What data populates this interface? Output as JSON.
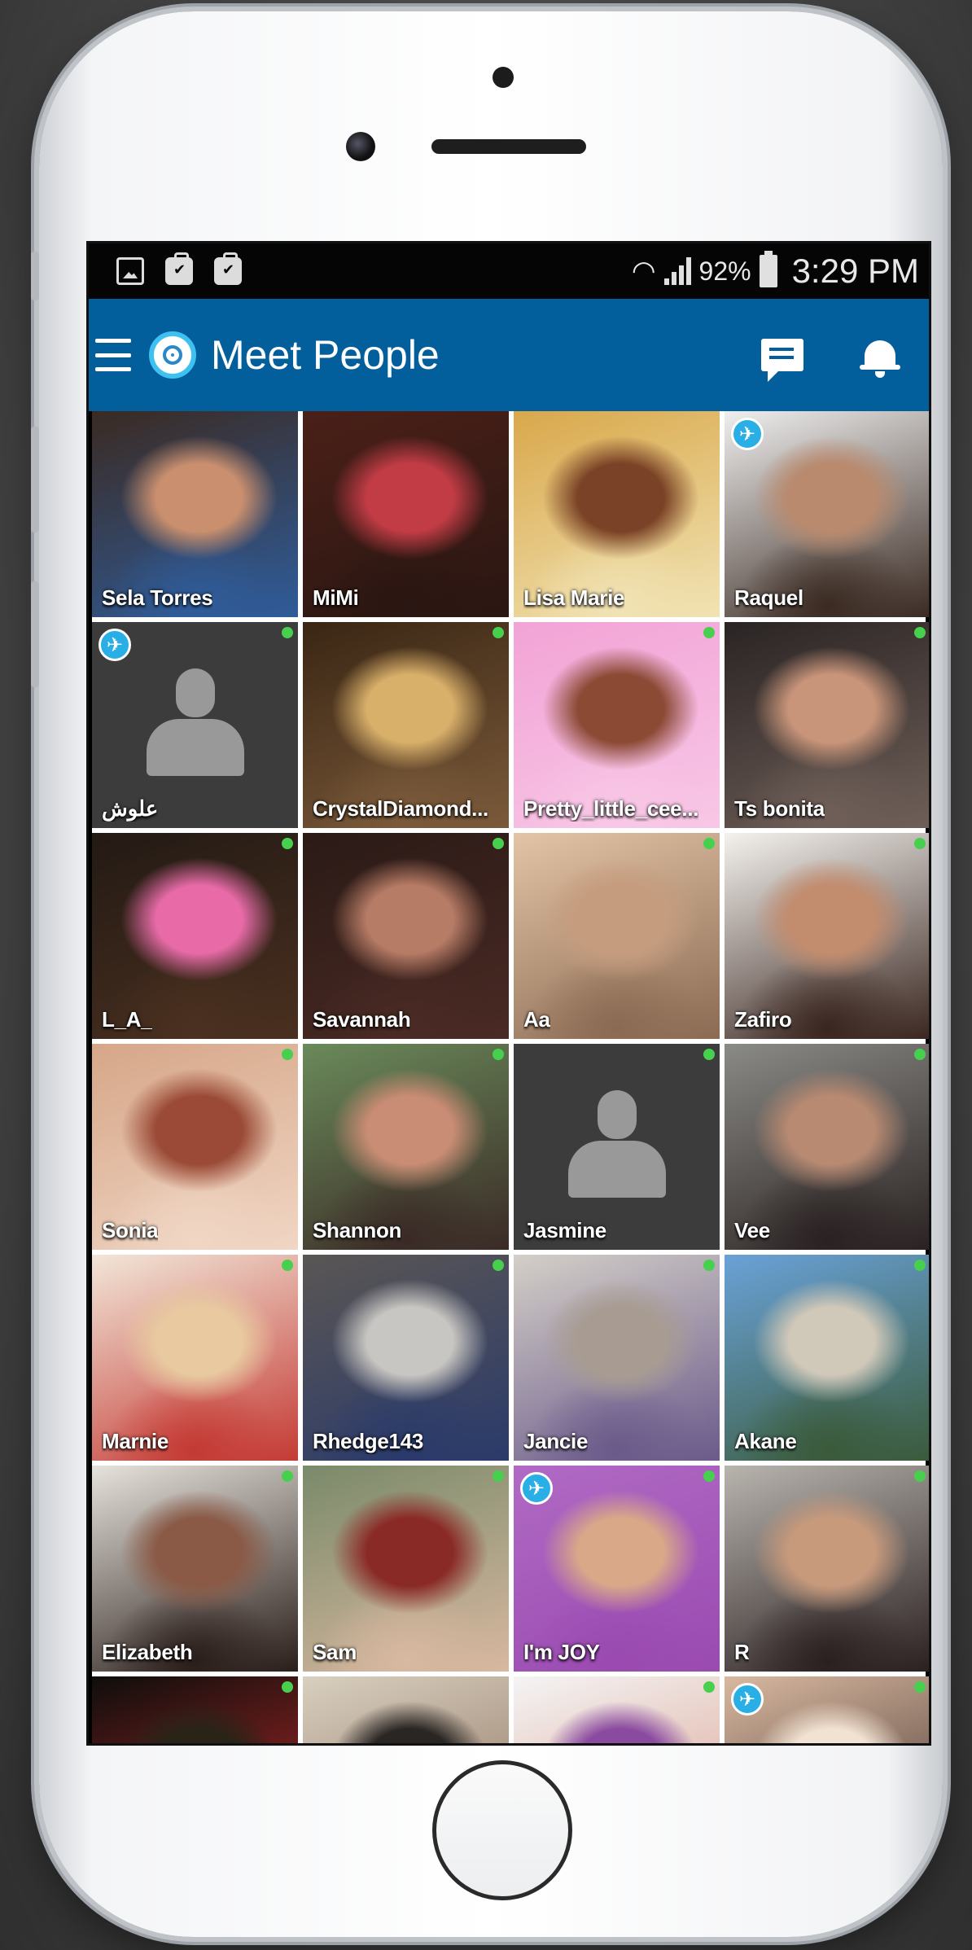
{
  "status_bar": {
    "left_icons": [
      "image-icon",
      "briefcase-check-icon",
      "briefcase-check-icon"
    ],
    "wifi_icon": "wifi-icon",
    "signal_icon": "signal-icon",
    "battery_percent": "92%",
    "battery_icon": "battery-icon",
    "time": "3:29 PM"
  },
  "app_bar": {
    "menu_icon": "hamburger-menu-icon",
    "logo_icon": "app-logo-icon",
    "title": "Meet People",
    "chat_icon": "chat-icon",
    "notifications_icon": "bell-icon",
    "background_color": "#035e9c"
  },
  "colors": {
    "online_indicator": "#47d04d",
    "travel_badge": "#29aee6",
    "placeholder_bg": "#3c3c3c"
  },
  "profiles": [
    {
      "name": "Sela Torres",
      "online": false,
      "travel": false,
      "photo": true,
      "tones": [
        "#3b2a22",
        "#c98f6e",
        "#2f5c9a"
      ]
    },
    {
      "name": "MiMi",
      "online": false,
      "travel": false,
      "photo": true,
      "tones": [
        "#4a2018",
        "#c23c46",
        "#2a1612"
      ]
    },
    {
      "name": "Lisa Marie",
      "online": false,
      "travel": false,
      "photo": true,
      "tones": [
        "#d9a84b",
        "#7a4226",
        "#f1e3b4"
      ]
    },
    {
      "name": "Raquel",
      "online": false,
      "travel": true,
      "photo": true,
      "tones": [
        "#efefef",
        "#b98a6e",
        "#3a2a22"
      ]
    },
    {
      "name": "علوش",
      "online": true,
      "travel": true,
      "photo": false,
      "tones": []
    },
    {
      "name": "CrystalDiamond...",
      "online": true,
      "travel": false,
      "photo": true,
      "tones": [
        "#3a2614",
        "#d9b06a",
        "#7b5a3a"
      ]
    },
    {
      "name": "Pretty_little_cee...",
      "online": true,
      "travel": false,
      "photo": true,
      "tones": [
        "#f2a3d6",
        "#8b4a34",
        "#f8c7e6"
      ]
    },
    {
      "name": "Ts bonita",
      "online": true,
      "travel": false,
      "photo": true,
      "tones": [
        "#2a2424",
        "#c9957a",
        "#6f5f58"
      ]
    },
    {
      "name": "L_A_",
      "online": true,
      "travel": false,
      "photo": true,
      "tones": [
        "#231a14",
        "#e86ba8",
        "#4a3020"
      ]
    },
    {
      "name": "Savannah",
      "online": true,
      "travel": false,
      "photo": true,
      "tones": [
        "#2a1a16",
        "#b77c66",
        "#4a2a24"
      ]
    },
    {
      "name": "Aa",
      "online": true,
      "travel": false,
      "photo": true,
      "tones": [
        "#e4c4a6",
        "#c69c7e",
        "#8a6a52"
      ]
    },
    {
      "name": "Zafiro",
      "online": true,
      "travel": false,
      "photo": true,
      "tones": [
        "#f4f2ee",
        "#c28c6e",
        "#3a2620"
      ]
    },
    {
      "name": "Sonia",
      "online": true,
      "travel": false,
      "photo": true,
      "tones": [
        "#d6a688",
        "#9a4a36",
        "#f0d6c4"
      ]
    },
    {
      "name": "Shannon",
      "online": true,
      "travel": false,
      "photo": true,
      "tones": [
        "#6a8a5a",
        "#c98c74",
        "#3a2a26"
      ]
    },
    {
      "name": "Jasmine",
      "online": true,
      "travel": false,
      "photo": false,
      "tones": []
    },
    {
      "name": "Vee",
      "online": true,
      "travel": false,
      "photo": true,
      "tones": [
        "#8a8a86",
        "#b88a72",
        "#2a2222"
      ]
    },
    {
      "name": "Marnie",
      "online": true,
      "travel": false,
      "photo": true,
      "tones": [
        "#f2e6d8",
        "#e8c9a0",
        "#c43a34"
      ]
    },
    {
      "name": "Rhedge143",
      "online": true,
      "travel": false,
      "photo": true,
      "tones": [
        "#5a5654",
        "#c8c6c2",
        "#2a3a6a"
      ]
    },
    {
      "name": "Jancie",
      "online": true,
      "travel": false,
      "photo": true,
      "tones": [
        "#d4cfc8",
        "#a89c92",
        "#6a5a8a"
      ]
    },
    {
      "name": "Akane",
      "online": true,
      "travel": false,
      "photo": true,
      "tones": [
        "#6aa2d8",
        "#d0c8b8",
        "#3a5a3a"
      ]
    },
    {
      "name": "Elizabeth",
      "online": true,
      "travel": false,
      "photo": true,
      "tones": [
        "#e6e2dc",
        "#8a5a46",
        "#2a1e1a"
      ]
    },
    {
      "name": "Sam",
      "online": true,
      "travel": false,
      "photo": true,
      "tones": [
        "#7a8a6a",
        "#8a2a26",
        "#d8b8a0"
      ]
    },
    {
      "name": "I'm JOY",
      "online": true,
      "travel": true,
      "photo": true,
      "tones": [
        "#b06ac4",
        "#d8a888",
        "#9a4ab0"
      ]
    },
    {
      "name": "R",
      "online": true,
      "travel": false,
      "photo": true,
      "tones": [
        "#b8b4ae",
        "#c89a7c",
        "#2a2020"
      ]
    },
    {
      "name": "",
      "online": true,
      "travel": false,
      "photo": true,
      "tones": [
        "#0e0e0c",
        "#2a2418",
        "#c42a2a"
      ]
    },
    {
      "name": "",
      "online": false,
      "travel": false,
      "photo": true,
      "tones": [
        "#d8d0c0",
        "#2a2624",
        "#8a6a58"
      ]
    },
    {
      "name": "",
      "online": true,
      "travel": false,
      "photo": true,
      "tones": [
        "#f4f4f4",
        "#8a4aa0",
        "#d89a88"
      ]
    },
    {
      "name": "",
      "online": true,
      "travel": true,
      "photo": true,
      "tones": [
        "#d8b8a0",
        "#f2e2d2",
        "#3a2a26"
      ]
    }
  ]
}
